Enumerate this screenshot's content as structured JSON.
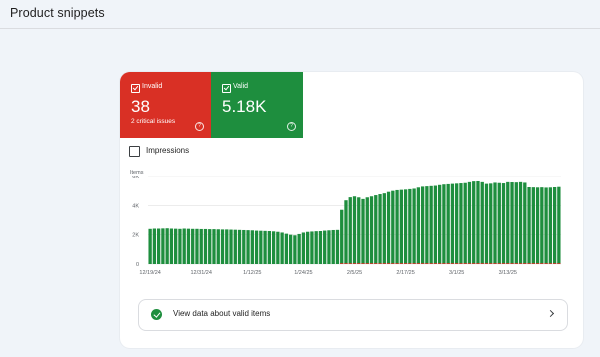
{
  "header": {
    "title": "Product snippets"
  },
  "tiles": {
    "invalid": {
      "label": "Invalid",
      "value": "38",
      "sub": "2 critical issues",
      "color": "#d93025"
    },
    "valid": {
      "label": "Valid",
      "value": "5.18K",
      "color": "#1e8e3e"
    }
  },
  "impressions": {
    "label": "Impressions",
    "checked": false
  },
  "chart_data": {
    "type": "bar",
    "ylabel": "Items",
    "ylim": [
      0,
      6000
    ],
    "y_ticks": [
      "6K",
      "4K",
      "2K",
      "0"
    ],
    "x_ticks": [
      "12/19/24",
      "12/31/24",
      "1/12/25",
      "1/24/25",
      "2/5/25",
      "2/17/25",
      "3/1/25",
      "3/13/25"
    ],
    "series": [
      {
        "color": "#1e8e3e",
        "values": [
          2400,
          2420,
          2420,
          2430,
          2440,
          2420,
          2410,
          2400,
          2420,
          2410,
          2400,
          2400,
          2390,
          2390,
          2380,
          2380,
          2370,
          2360,
          2360,
          2350,
          2340,
          2330,
          2320,
          2310,
          2300,
          2280,
          2270,
          2260,
          2250,
          2230,
          2200,
          2150,
          2070,
          2000,
          1960,
          2050,
          2150,
          2200,
          2220,
          2240,
          2250,
          2280,
          2300,
          2320,
          2330,
          3700,
          4350,
          4560,
          4620,
          4550,
          4440,
          4550,
          4620,
          4700,
          4770,
          4830,
          4930,
          5000,
          5050,
          5070,
          5090,
          5120,
          5150,
          5230,
          5290,
          5310,
          5330,
          5350,
          5400,
          5440,
          5460,
          5480,
          5500,
          5520,
          5540,
          5600,
          5650,
          5660,
          5600,
          5480,
          5500,
          5560,
          5540,
          5520,
          5600,
          5590,
          5580,
          5600,
          5560,
          5250,
          5240,
          5230,
          5240,
          5220,
          5230,
          5250,
          5270
        ]
      },
      {
        "color": "#d93025",
        "values": [
          0,
          0,
          0,
          0,
          0,
          0,
          0,
          0,
          0,
          0,
          0,
          0,
          0,
          0,
          0,
          0,
          0,
          0,
          0,
          0,
          0,
          0,
          0,
          0,
          0,
          0,
          0,
          0,
          0,
          0,
          0,
          0,
          0,
          0,
          0,
          0,
          0,
          0,
          0,
          0,
          0,
          0,
          0,
          0,
          0,
          30,
          40,
          40,
          40,
          40,
          40,
          40,
          40,
          40,
          40,
          40,
          40,
          40,
          40,
          40,
          40,
          40,
          40,
          40,
          40,
          40,
          40,
          40,
          40,
          40,
          40,
          40,
          40,
          40,
          40,
          40,
          40,
          40,
          40,
          40,
          40,
          40,
          40,
          40,
          40,
          40,
          40,
          40,
          40,
          38,
          38,
          38,
          38,
          38,
          38,
          38,
          38
        ]
      }
    ],
    "grid": true
  },
  "footer": {
    "label": "View data about valid items"
  }
}
